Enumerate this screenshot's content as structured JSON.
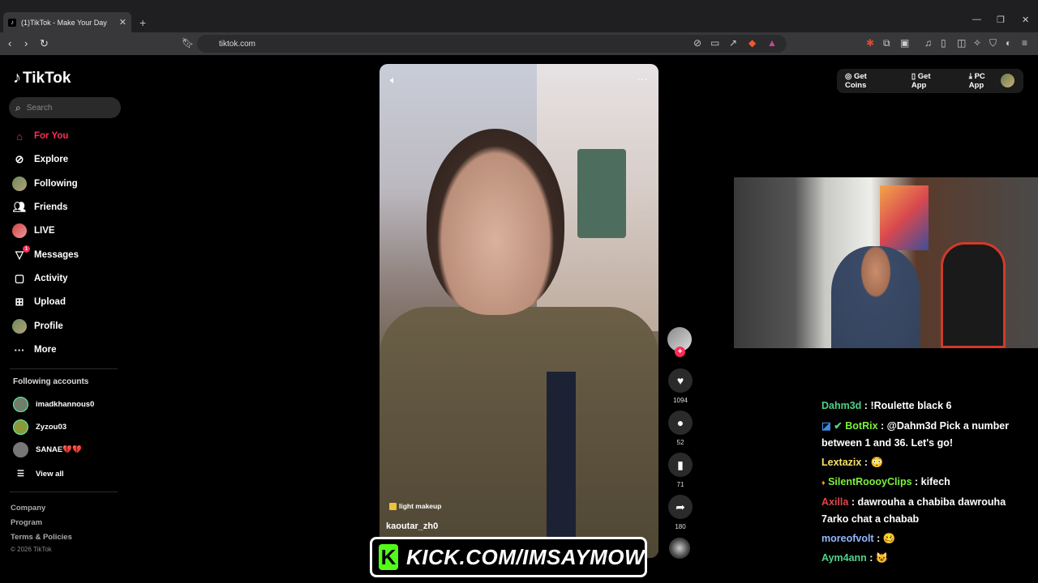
{
  "browser": {
    "tab_title": "(1)TikTok - Make Your Day",
    "url": "tiktok.com"
  },
  "sidebar": {
    "logo": "TikTok",
    "search_placeholder": "Search",
    "nav": [
      {
        "label": "For You",
        "icon": "home-icon",
        "active": true
      },
      {
        "label": "Explore",
        "icon": "compass-icon"
      },
      {
        "label": "Following",
        "icon": "avatar-icon"
      },
      {
        "label": "Friends",
        "icon": "friends-icon"
      },
      {
        "label": "LIVE",
        "icon": "live-avatar-icon"
      },
      {
        "label": "Messages",
        "icon": "messages-icon",
        "badge": "1"
      },
      {
        "label": "Activity",
        "icon": "activity-icon"
      },
      {
        "label": "Upload",
        "icon": "upload-icon"
      },
      {
        "label": "Profile",
        "icon": "profile-avatar-icon"
      },
      {
        "label": "More",
        "icon": "more-icon"
      }
    ],
    "following_title": "Following accounts",
    "following": [
      "imadkhannous0",
      "Zyzou03",
      "SANAE💔💔"
    ],
    "view_all": "View all",
    "footer": [
      "Company",
      "Program",
      "Terms & Policies"
    ],
    "copyright": "© 2026 TikTok"
  },
  "video": {
    "tag": "light makeup",
    "username": "kaoutar_zh0",
    "likes": "1094",
    "comments": "52",
    "saves": "71",
    "shares": "180"
  },
  "topbar": {
    "coins": "Get Coins",
    "app": "Get App",
    "pc_app": "PC App"
  },
  "chat": [
    {
      "user": "Dahm3d",
      "color": "#4fd18b",
      "msg": "!Roulette black 6"
    },
    {
      "user": "BotRix",
      "color": "#7cf03c",
      "msg": "@Dahm3d Pick a number between 1 and 36. Let's go!"
    },
    {
      "user": "Lextazix",
      "color": "#f5e26a",
      "msg": "😳"
    },
    {
      "user": "SilentRoooyClips",
      "color": "#7cf03c",
      "msg": "kifech"
    },
    {
      "user": "Axilla",
      "color": "#e0454a",
      "msg": "dawrouha a chabiba dawrouha 7arko chat a chabab"
    },
    {
      "user": "moreofvolt",
      "color": "#8fb8ff",
      "msg": "🥴"
    },
    {
      "user": "Aym4ann",
      "color": "#4fd18b",
      "msg": "😺"
    }
  ],
  "kick_banner": "KICK.COM/IMSAYMOW",
  "colors": {
    "accent": "#fe2c55",
    "kick": "#53fc18"
  }
}
